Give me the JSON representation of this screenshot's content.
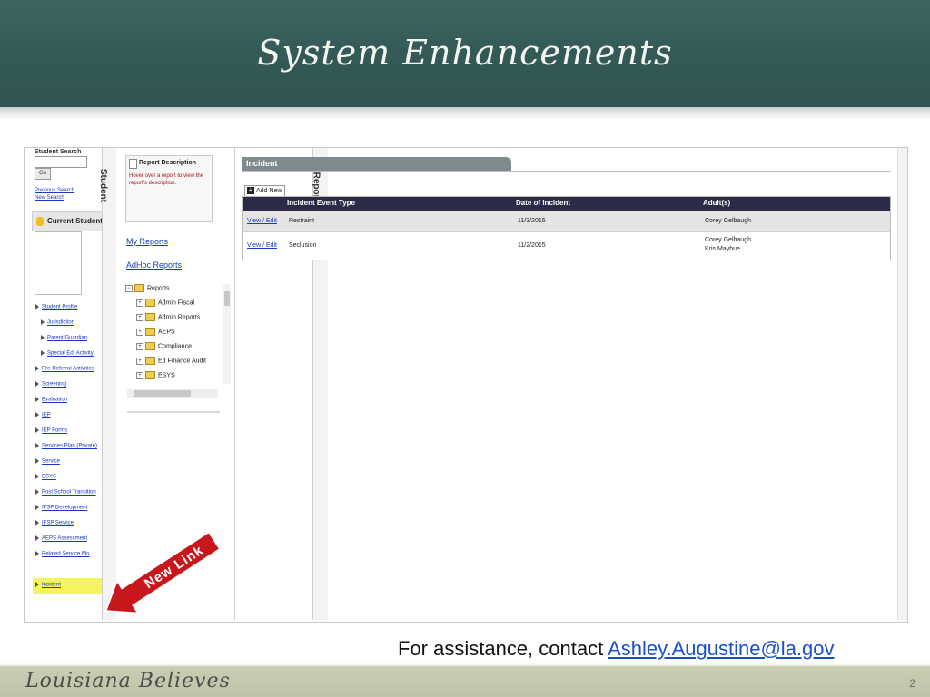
{
  "slide": {
    "title": "System Enhancements",
    "assistance_text": "For assistance, contact ",
    "assistance_email": "Ashley.Augustine@la.gov",
    "footer_brand": "Louisiana Believes",
    "page_number": "2",
    "callout_label": "New Link"
  },
  "student_panel": {
    "search_label": "Student Search",
    "go_label": "Go",
    "previous_search": "Previous Search",
    "new_search": "New Search",
    "tab_label": "Student",
    "current_student_label": "Current Student",
    "nav": [
      {
        "label": "Student Profile"
      },
      {
        "label": "Jurisdiction"
      },
      {
        "label": "Parent/Guardian"
      },
      {
        "label": "Special Ed. Activity"
      },
      {
        "label": "Pre-Referral Activities"
      },
      {
        "label": "Screening"
      },
      {
        "label": "Evaluation"
      },
      {
        "label": "IEP"
      },
      {
        "label": "IEP Forms"
      },
      {
        "label": "Services Plan (Private)"
      },
      {
        "label": "Service"
      },
      {
        "label": "ESYS"
      },
      {
        "label": "Post School Transition"
      },
      {
        "label": "IFSP Development"
      },
      {
        "label": "IFSP Service"
      },
      {
        "label": "AEPS Assessment"
      },
      {
        "label": "Related Service Mo"
      },
      {
        "label": "Incident"
      }
    ]
  },
  "reports_panel": {
    "tab_label": "Reports",
    "description_title": "Report Description",
    "description_text": "Hover over a report to view the report's description.",
    "my_reports": "My Reports",
    "adhoc_reports": "AdHoc Reports",
    "tree_root": "Reports",
    "tree_items": [
      "Admin Fiscal",
      "Admin Reports",
      "AEPS",
      "Compliance",
      "Ed Finance Audit",
      "ESYS"
    ]
  },
  "incident_panel": {
    "tab_label": "Incident",
    "add_new_label": "Add New",
    "columns": [
      "Incident Event Type",
      "Date of Incident",
      "Adult(s)"
    ],
    "rows": [
      {
        "action": "View / Edit",
        "type": "Restraint",
        "date": "11/3/2015",
        "adult_1": "Corey Gelbaugh",
        "adult_2": ""
      },
      {
        "action": "View / Edit",
        "type": "Seclusion",
        "date": "11/2/2015",
        "adult_1": "Corey Gelbaugh",
        "adult_2": "Kris Mayhue"
      }
    ]
  },
  "colors": {
    "chalkboard": "#345a57",
    "callout_red": "#c8161d",
    "table_header": "#2b2b48",
    "highlight": "#f4f460"
  }
}
